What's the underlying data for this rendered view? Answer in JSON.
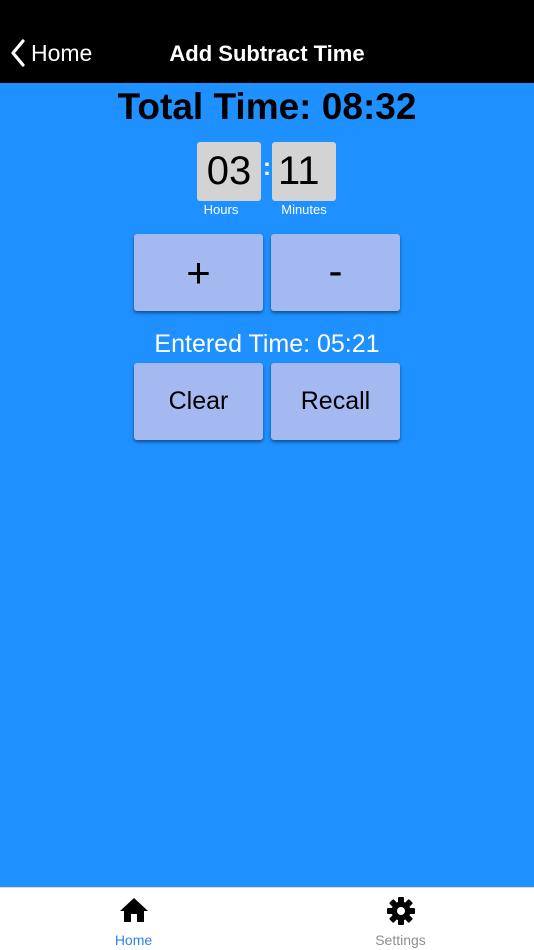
{
  "nav": {
    "back_label": "Home",
    "title": "Add Subtract Time"
  },
  "main": {
    "total_time": "Total Time: 08:32",
    "hours_value": "03",
    "minutes_value": "11",
    "colon": ":",
    "hours_label": "Hours",
    "minutes_label": "Minutes",
    "plus_label": "+",
    "minus_label": "-",
    "entered_time": "Entered Time: 05:21",
    "clear_label": "Clear",
    "recall_label": "Recall"
  },
  "tabs": [
    {
      "label": "Home",
      "icon": "home-icon",
      "active": true
    },
    {
      "label": "Settings",
      "icon": "gear-icon",
      "active": false
    }
  ],
  "colors": {
    "background": "#1e90ff",
    "button": "#a4b9ef",
    "time_box": "#d3d3d3",
    "active_tab": "#2f80ed",
    "inactive_tab": "#8e8e8e"
  }
}
